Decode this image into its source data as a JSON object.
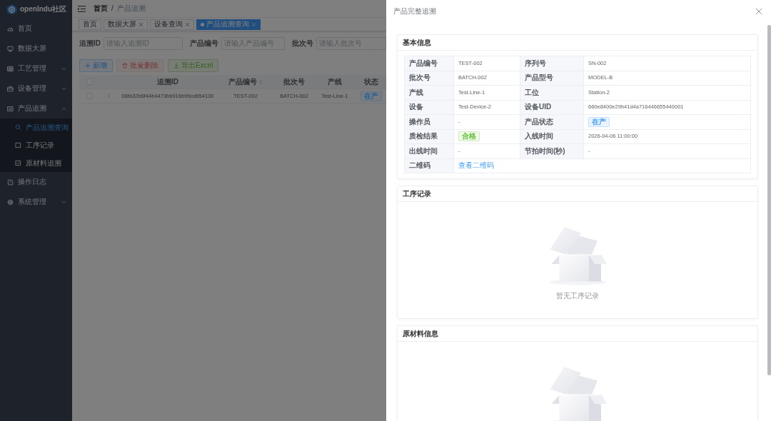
{
  "sidebar": {
    "brand": "openIndu社区",
    "items": [
      {
        "kind": "link",
        "label": "首页",
        "selected": false
      },
      {
        "kind": "link",
        "label": "数据大屏",
        "selected": false
      },
      {
        "kind": "group",
        "label": "工艺管理",
        "expanded": false
      },
      {
        "kind": "group",
        "label": "设备管理",
        "expanded": false
      },
      {
        "kind": "group",
        "label": "产品追溯",
        "expanded": true,
        "children": [
          {
            "label": "产品追溯查询",
            "selected": true
          },
          {
            "label": "工序记录",
            "selected": false
          },
          {
            "label": "原材料追溯",
            "selected": false
          }
        ]
      },
      {
        "kind": "link",
        "label": "操作日志",
        "selected": false
      },
      {
        "kind": "group",
        "label": "系统管理",
        "expanded": false
      }
    ]
  },
  "header": {
    "breadcrumb": [
      "首页",
      "产品追溯"
    ],
    "separator": "/"
  },
  "tabs": [
    {
      "label": "首页",
      "closable": false,
      "selected": false
    },
    {
      "label": "数据大屏",
      "closable": true,
      "selected": false
    },
    {
      "label": "设备查询",
      "closable": true,
      "selected": false
    },
    {
      "label": "产品追溯查询",
      "closable": true,
      "selected": true
    }
  ],
  "search_fields": [
    {
      "label": "追溯ID",
      "placeholder": "请输入追溯ID"
    },
    {
      "label": "产品编号",
      "placeholder": "请输入产品编号"
    },
    {
      "label": "批次号",
      "placeholder": "请输入批次号"
    }
  ],
  "toolbar": [
    {
      "kind": "add",
      "label": "新增",
      "disabled": false
    },
    {
      "kind": "delete",
      "label": "批量删除",
      "disabled": true
    },
    {
      "kind": "export",
      "label": "导出Excel",
      "disabled": false
    }
  ],
  "table": {
    "all_checked": false,
    "columns": [
      {
        "label": "追溯ID",
        "sortable": false
      },
      {
        "label": "产品编号",
        "sortable": true
      },
      {
        "label": "批次号",
        "sortable": false
      },
      {
        "label": "产线",
        "sortable": false
      },
      {
        "label": "状态",
        "sortable": false
      }
    ],
    "rows": [
      {
        "checked": false,
        "expanded": false,
        "cells": [
          {
            "kind": "text",
            "value": "08fa32b6f44b4473b6916b99cd654130"
          },
          {
            "kind": "text",
            "value": "TEST-002"
          },
          {
            "kind": "text",
            "value": "BATCH-002"
          },
          {
            "kind": "text",
            "value": "Test-Line-1"
          },
          {
            "kind": "tag",
            "value": "在产",
            "color": "#2a5f94"
          }
        ]
      }
    ]
  },
  "drawer": {
    "open": true,
    "title": "产品完整追溯",
    "sections": [
      {
        "kind": "fields",
        "title": "基本信息",
        "fields": [
          {
            "kind": "text",
            "label": "产品编号",
            "value": "TEST-002"
          },
          {
            "kind": "text",
            "label": "序列号",
            "value": "SN-002"
          },
          {
            "kind": "text",
            "label": "批次号",
            "value": "BATCH-002"
          },
          {
            "kind": "text",
            "label": "产品型号",
            "value": "MODEL-B"
          },
          {
            "kind": "text",
            "label": "产线",
            "value": "Test-Line-1"
          },
          {
            "kind": "text",
            "label": "工位",
            "value": "Station-2"
          },
          {
            "kind": "text",
            "label": "设备",
            "value": "Test-Device-2"
          },
          {
            "kind": "text",
            "label": "设备UID",
            "value": "660e8400e29b41d4a716446655440001"
          },
          {
            "kind": "text",
            "label": "操作员",
            "value": "-"
          },
          {
            "kind": "tag",
            "label": "产品状态",
            "value": "在产",
            "color": "#409eff"
          },
          {
            "kind": "tag",
            "label": "质检结果",
            "value": "合格",
            "color": "#67c23a"
          },
          {
            "kind": "text",
            "label": "入线时间",
            "value": "2026-04-06 11:00:00"
          },
          {
            "kind": "text",
            "label": "出线时间",
            "value": "-"
          },
          {
            "kind": "text",
            "label": "节拍时间(秒)",
            "value": "-"
          },
          {
            "kind": "link",
            "label": "二维码",
            "value": "查看二维码"
          }
        ]
      },
      {
        "kind": "empty",
        "title": "工序记录",
        "empty_text": "暂无工序记录"
      },
      {
        "kind": "empty",
        "title": "原材料信息"
      }
    ]
  }
}
